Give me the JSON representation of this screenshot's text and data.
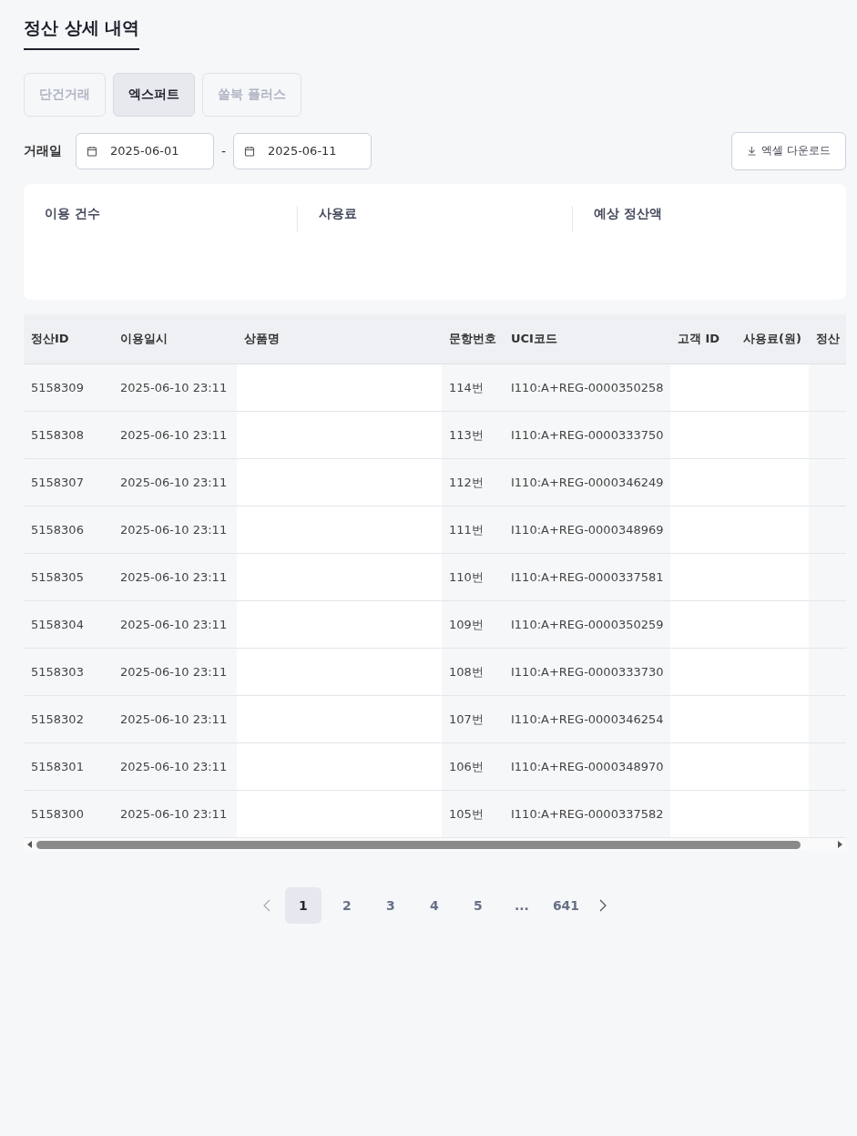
{
  "page_title": "정산 상세 내역",
  "tabs": [
    {
      "label": "단건거래",
      "selected": false
    },
    {
      "label": "엑스퍼트",
      "selected": true
    },
    {
      "label": "쏠북 플러스",
      "selected": false
    }
  ],
  "date_filter": {
    "label": "거래일",
    "start": "2025-06-01",
    "separator": "-",
    "end": "2025-06-11"
  },
  "download_button": "엑셀 다운로드",
  "summary": [
    {
      "label": "이용 건수"
    },
    {
      "label": "사용료"
    },
    {
      "label": "예상 정산액"
    }
  ],
  "table": {
    "columns": [
      "정산ID",
      "이용일시",
      "상품명",
      "문항번호",
      "UCI코드",
      "고객 ID",
      "사용료(원)",
      "정산"
    ],
    "rows": [
      [
        "5158309",
        "2025-06-10 23:11",
        null,
        "114번",
        "I110:A+REG-0000350258",
        null,
        null,
        null
      ],
      [
        "5158308",
        "2025-06-10 23:11",
        null,
        "113번",
        "I110:A+REG-0000333750",
        null,
        null,
        null
      ],
      [
        "5158307",
        "2025-06-10 23:11",
        null,
        "112번",
        "I110:A+REG-0000346249",
        null,
        null,
        null
      ],
      [
        "5158306",
        "2025-06-10 23:11",
        null,
        "111번",
        "I110:A+REG-0000348969",
        null,
        null,
        null
      ],
      [
        "5158305",
        "2025-06-10 23:11",
        null,
        "110번",
        "I110:A+REG-0000337581",
        null,
        null,
        null
      ],
      [
        "5158304",
        "2025-06-10 23:11",
        null,
        "109번",
        "I110:A+REG-0000350259",
        null,
        null,
        null
      ],
      [
        "5158303",
        "2025-06-10 23:11",
        null,
        "108번",
        "I110:A+REG-0000333730",
        null,
        null,
        null
      ],
      [
        "5158302",
        "2025-06-10 23:11",
        null,
        "107번",
        "I110:A+REG-0000346254",
        null,
        null,
        null
      ],
      [
        "5158301",
        "2025-06-10 23:11",
        null,
        "106번",
        "I110:A+REG-0000348970",
        null,
        null,
        null
      ],
      [
        "5158300",
        "2025-06-10 23:11",
        null,
        "105번",
        "I110:A+REG-0000337582",
        null,
        null,
        null
      ]
    ]
  },
  "pagination": {
    "pages": [
      {
        "label": "1",
        "selected": true
      },
      {
        "label": "2",
        "selected": false
      },
      {
        "label": "3",
        "selected": false
      },
      {
        "label": "4",
        "selected": false
      },
      {
        "label": "5",
        "selected": false
      },
      {
        "label": "...",
        "selected": false
      },
      {
        "label": "641",
        "selected": false
      }
    ]
  }
}
